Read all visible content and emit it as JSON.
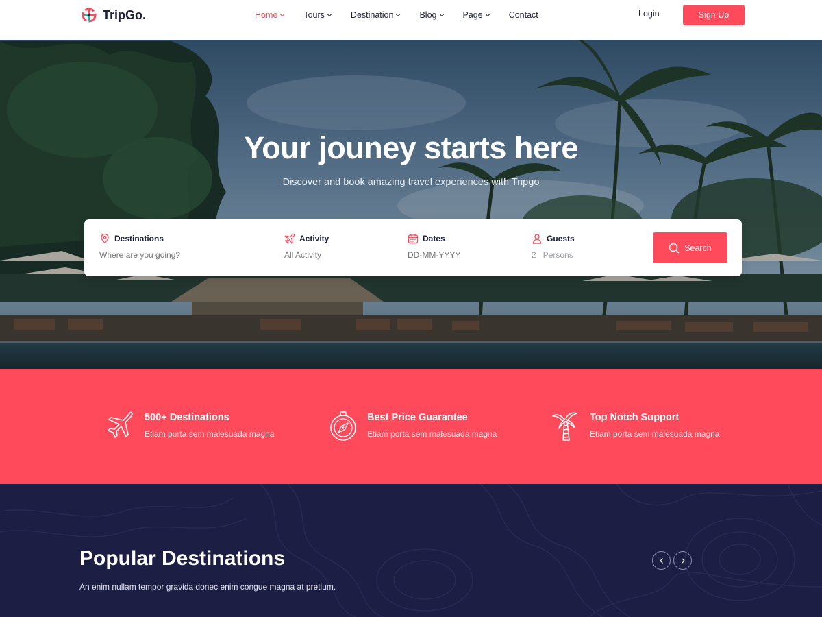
{
  "brand": {
    "name": "TripGo.",
    "accent": "#ff4a5c",
    "dark": "#1d1e44"
  },
  "nav": {
    "items": [
      {
        "label": "Home",
        "dropdown": true,
        "active": true
      },
      {
        "label": "Tours",
        "dropdown": true
      },
      {
        "label": "Destination",
        "dropdown": true
      },
      {
        "label": "Blog",
        "dropdown": true
      },
      {
        "label": "Page",
        "dropdown": true
      },
      {
        "label": "Contact",
        "dropdown": false
      }
    ],
    "login": "Login",
    "signup": "Sign Up"
  },
  "hero": {
    "title": "Your jouney starts here",
    "subtitle": "Discover and book amazing travel experiences with Tripgo"
  },
  "search": {
    "destinations": {
      "label": "Destinations",
      "placeholder": "Where are you going?",
      "icon": "map-pin-icon"
    },
    "activity": {
      "label": "Activity",
      "placeholder": "All Activity",
      "icon": "plane-icon"
    },
    "dates": {
      "label": "Dates",
      "placeholder": "DD-MM-YYYY",
      "icon": "calendar-icon"
    },
    "guests": {
      "label": "Guests",
      "count": "2",
      "unit": "Persons",
      "icon": "user-icon"
    },
    "button": "Search"
  },
  "features": [
    {
      "title": "500+ Destinations",
      "desc": "Etiam porta sem malesuada magna",
      "icon": "airplane-icon"
    },
    {
      "title": "Best Price Guarantee",
      "desc": "Etiam porta sem malesuada magna",
      "icon": "compass-icon"
    },
    {
      "title": "Top Notch Support",
      "desc": "Etiam porta sem malesuada magna",
      "icon": "palm-tree-icon"
    }
  ],
  "popular": {
    "title": "Popular Destinations",
    "desc": "An enim nullam tempor gravida donec enim congue magna at pretium."
  }
}
